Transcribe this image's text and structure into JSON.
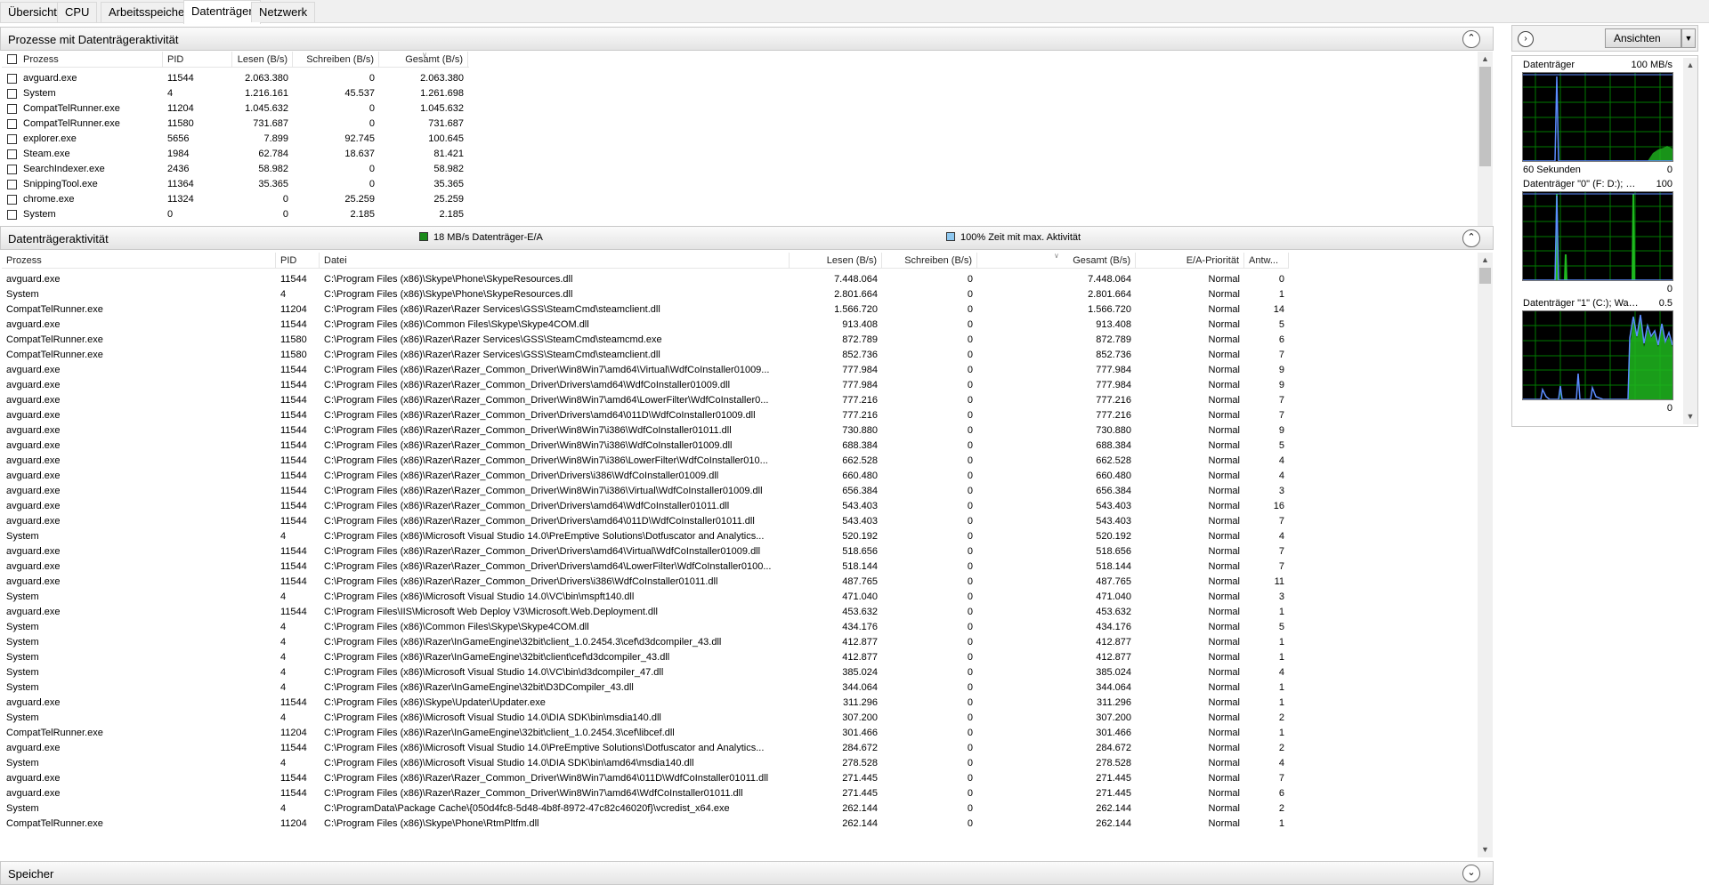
{
  "tabs": [
    {
      "label": "Übersicht",
      "active": false
    },
    {
      "label": "CPU",
      "active": false
    },
    {
      "label": "Arbeitsspeicher",
      "active": false
    },
    {
      "label": "Datenträger",
      "active": true
    },
    {
      "label": "Netzwerk",
      "active": false
    }
  ],
  "processes_section": {
    "title": "Prozesse mit Datenträgeraktivität",
    "columns": [
      "Prozess",
      "PID",
      "Lesen (B/s)",
      "Schreiben (B/s)",
      "Gesamt (B/s)"
    ],
    "rows": [
      [
        "avguard.exe",
        "11544",
        "2.063.380",
        "0",
        "2.063.380"
      ],
      [
        "System",
        "4",
        "1.216.161",
        "45.537",
        "1.261.698"
      ],
      [
        "CompatTelRunner.exe",
        "11204",
        "1.045.632",
        "0",
        "1.045.632"
      ],
      [
        "CompatTelRunner.exe",
        "11580",
        "731.687",
        "0",
        "731.687"
      ],
      [
        "explorer.exe",
        "5656",
        "7.899",
        "92.745",
        "100.645"
      ],
      [
        "Steam.exe",
        "1984",
        "62.784",
        "18.637",
        "81.421"
      ],
      [
        "SearchIndexer.exe",
        "2436",
        "58.982",
        "0",
        "58.982"
      ],
      [
        "SnippingTool.exe",
        "11364",
        "35.365",
        "0",
        "35.365"
      ],
      [
        "chrome.exe",
        "11324",
        "0",
        "25.259",
        "25.259"
      ],
      [
        "System",
        "0",
        "0",
        "2.185",
        "2.185"
      ]
    ]
  },
  "activity_section": {
    "title": "Datenträgeraktivität",
    "legend_io": "18 MB/s Datenträger-E/A",
    "legend_time": "100% Zeit mit max. Aktivität",
    "colors": {
      "io": "#1a8a1a",
      "time": "#8ec8f0"
    },
    "columns": [
      "Prozess",
      "PID",
      "Datei",
      "Lesen (B/s)",
      "Schreiben (B/s)",
      "Gesamt (B/s)",
      "E/A-Priorität",
      "Antw..."
    ],
    "rows": [
      [
        "avguard.exe",
        "11544",
        "C:\\Program Files (x86)\\Skype\\Phone\\SkypeResources.dll",
        "7.448.064",
        "0",
        "7.448.064",
        "Normal",
        "0"
      ],
      [
        "System",
        "4",
        "C:\\Program Files (x86)\\Skype\\Phone\\SkypeResources.dll",
        "2.801.664",
        "0",
        "2.801.664",
        "Normal",
        "1"
      ],
      [
        "CompatTelRunner.exe",
        "11204",
        "C:\\Program Files (x86)\\Razer\\Razer Services\\GSS\\SteamCmd\\steamclient.dll",
        "1.566.720",
        "0",
        "1.566.720",
        "Normal",
        "14"
      ],
      [
        "avguard.exe",
        "11544",
        "C:\\Program Files (x86)\\Common Files\\Skype\\Skype4COM.dll",
        "913.408",
        "0",
        "913.408",
        "Normal",
        "5"
      ],
      [
        "CompatTelRunner.exe",
        "11580",
        "C:\\Program Files (x86)\\Razer\\Razer Services\\GSS\\SteamCmd\\steamcmd.exe",
        "872.789",
        "0",
        "872.789",
        "Normal",
        "6"
      ],
      [
        "CompatTelRunner.exe",
        "11580",
        "C:\\Program Files (x86)\\Razer\\Razer Services\\GSS\\SteamCmd\\steamclient.dll",
        "852.736",
        "0",
        "852.736",
        "Normal",
        "7"
      ],
      [
        "avguard.exe",
        "11544",
        "C:\\Program Files (x86)\\Razer\\Razer_Common_Driver\\Win8Win7\\amd64\\Virtual\\WdfCoInstaller01009...",
        "777.984",
        "0",
        "777.984",
        "Normal",
        "9"
      ],
      [
        "avguard.exe",
        "11544",
        "C:\\Program Files (x86)\\Razer\\Razer_Common_Driver\\Drivers\\amd64\\WdfCoInstaller01009.dll",
        "777.984",
        "0",
        "777.984",
        "Normal",
        "9"
      ],
      [
        "avguard.exe",
        "11544",
        "C:\\Program Files (x86)\\Razer\\Razer_Common_Driver\\Win8Win7\\amd64\\LowerFilter\\WdfCoInstaller0...",
        "777.216",
        "0",
        "777.216",
        "Normal",
        "7"
      ],
      [
        "avguard.exe",
        "11544",
        "C:\\Program Files (x86)\\Razer\\Razer_Common_Driver\\Drivers\\amd64\\011D\\WdfCoInstaller01009.dll",
        "777.216",
        "0",
        "777.216",
        "Normal",
        "7"
      ],
      [
        "avguard.exe",
        "11544",
        "C:\\Program Files (x86)\\Razer\\Razer_Common_Driver\\Win8Win7\\i386\\WdfCoInstaller01011.dll",
        "730.880",
        "0",
        "730.880",
        "Normal",
        "9"
      ],
      [
        "avguard.exe",
        "11544",
        "C:\\Program Files (x86)\\Razer\\Razer_Common_Driver\\Win8Win7\\i386\\WdfCoInstaller01009.dll",
        "688.384",
        "0",
        "688.384",
        "Normal",
        "5"
      ],
      [
        "avguard.exe",
        "11544",
        "C:\\Program Files (x86)\\Razer\\Razer_Common_Driver\\Win8Win7\\i386\\LowerFilter\\WdfCoInstaller010...",
        "662.528",
        "0",
        "662.528",
        "Normal",
        "4"
      ],
      [
        "avguard.exe",
        "11544",
        "C:\\Program Files (x86)\\Razer\\Razer_Common_Driver\\Drivers\\i386\\WdfCoInstaller01009.dll",
        "660.480",
        "0",
        "660.480",
        "Normal",
        "4"
      ],
      [
        "avguard.exe",
        "11544",
        "C:\\Program Files (x86)\\Razer\\Razer_Common_Driver\\Win8Win7\\i386\\Virtual\\WdfCoInstaller01009.dll",
        "656.384",
        "0",
        "656.384",
        "Normal",
        "3"
      ],
      [
        "avguard.exe",
        "11544",
        "C:\\Program Files (x86)\\Razer\\Razer_Common_Driver\\Drivers\\amd64\\WdfCoInstaller01011.dll",
        "543.403",
        "0",
        "543.403",
        "Normal",
        "16"
      ],
      [
        "avguard.exe",
        "11544",
        "C:\\Program Files (x86)\\Razer\\Razer_Common_Driver\\Drivers\\amd64\\011D\\WdfCoInstaller01011.dll",
        "543.403",
        "0",
        "543.403",
        "Normal",
        "7"
      ],
      [
        "System",
        "4",
        "C:\\Program Files (x86)\\Microsoft Visual Studio 14.0\\PreEmptive Solutions\\Dotfuscator and Analytics...",
        "520.192",
        "0",
        "520.192",
        "Normal",
        "4"
      ],
      [
        "avguard.exe",
        "11544",
        "C:\\Program Files (x86)\\Razer\\Razer_Common_Driver\\Drivers\\amd64\\Virtual\\WdfCoInstaller01009.dll",
        "518.656",
        "0",
        "518.656",
        "Normal",
        "7"
      ],
      [
        "avguard.exe",
        "11544",
        "C:\\Program Files (x86)\\Razer\\Razer_Common_Driver\\Drivers\\amd64\\LowerFilter\\WdfCoInstaller0100...",
        "518.144",
        "0",
        "518.144",
        "Normal",
        "7"
      ],
      [
        "avguard.exe",
        "11544",
        "C:\\Program Files (x86)\\Razer\\Razer_Common_Driver\\Drivers\\i386\\WdfCoInstaller01011.dll",
        "487.765",
        "0",
        "487.765",
        "Normal",
        "11"
      ],
      [
        "System",
        "4",
        "C:\\Program Files (x86)\\Microsoft Visual Studio 14.0\\VC\\bin\\mspft140.dll",
        "471.040",
        "0",
        "471.040",
        "Normal",
        "3"
      ],
      [
        "avguard.exe",
        "11544",
        "C:\\Program Files\\IIS\\Microsoft Web Deploy V3\\Microsoft.Web.Deployment.dll",
        "453.632",
        "0",
        "453.632",
        "Normal",
        "1"
      ],
      [
        "System",
        "4",
        "C:\\Program Files (x86)\\Common Files\\Skype\\Skype4COM.dll",
        "434.176",
        "0",
        "434.176",
        "Normal",
        "5"
      ],
      [
        "System",
        "4",
        "C:\\Program Files (x86)\\Razer\\InGameEngine\\32bit\\client_1.0.2454.3\\cef\\d3dcompiler_43.dll",
        "412.877",
        "0",
        "412.877",
        "Normal",
        "1"
      ],
      [
        "System",
        "4",
        "C:\\Program Files (x86)\\Razer\\InGameEngine\\32bit\\client\\cef\\d3dcompiler_43.dll",
        "412.877",
        "0",
        "412.877",
        "Normal",
        "1"
      ],
      [
        "System",
        "4",
        "C:\\Program Files (x86)\\Microsoft Visual Studio 14.0\\VC\\bin\\d3dcompiler_47.dll",
        "385.024",
        "0",
        "385.024",
        "Normal",
        "4"
      ],
      [
        "System",
        "4",
        "C:\\Program Files (x86)\\Razer\\InGameEngine\\32bit\\D3DCompiler_43.dll",
        "344.064",
        "0",
        "344.064",
        "Normal",
        "1"
      ],
      [
        "avguard.exe",
        "11544",
        "C:\\Program Files (x86)\\Skype\\Updater\\Updater.exe",
        "311.296",
        "0",
        "311.296",
        "Normal",
        "1"
      ],
      [
        "System",
        "4",
        "C:\\Program Files (x86)\\Microsoft Visual Studio 14.0\\DIA SDK\\bin\\msdia140.dll",
        "307.200",
        "0",
        "307.200",
        "Normal",
        "2"
      ],
      [
        "CompatTelRunner.exe",
        "11204",
        "C:\\Program Files (x86)\\Razer\\InGameEngine\\32bit\\client_1.0.2454.3\\cef\\libcef.dll",
        "301.466",
        "0",
        "301.466",
        "Normal",
        "1"
      ],
      [
        "avguard.exe",
        "11544",
        "C:\\Program Files (x86)\\Microsoft Visual Studio 14.0\\PreEmptive Solutions\\Dotfuscator and Analytics...",
        "284.672",
        "0",
        "284.672",
        "Normal",
        "2"
      ],
      [
        "System",
        "4",
        "C:\\Program Files (x86)\\Microsoft Visual Studio 14.0\\DIA SDK\\bin\\amd64\\msdia140.dll",
        "278.528",
        "0",
        "278.528",
        "Normal",
        "4"
      ],
      [
        "avguard.exe",
        "11544",
        "C:\\Program Files (x86)\\Razer\\Razer_Common_Driver\\Win8Win7\\amd64\\011D\\WdfCoInstaller01011.dll",
        "271.445",
        "0",
        "271.445",
        "Normal",
        "7"
      ],
      [
        "avguard.exe",
        "11544",
        "C:\\Program Files (x86)\\Razer\\Razer_Common_Driver\\Win8Win7\\amd64\\WdfCoInstaller01011.dll",
        "271.445",
        "0",
        "271.445",
        "Normal",
        "6"
      ],
      [
        "System",
        "4",
        "C:\\ProgramData\\Package Cache\\{050d4fc8-5d48-4b8f-8972-47c82c46020f}\\vcredist_x64.exe",
        "262.144",
        "0",
        "262.144",
        "Normal",
        "2"
      ],
      [
        "CompatTelRunner.exe",
        "11204",
        "C:\\Program Files (x86)\\Skype\\Phone\\RtmPltfm.dll",
        "262.144",
        "0",
        "262.144",
        "Normal",
        "1"
      ]
    ]
  },
  "memory_section": {
    "title": "Speicher"
  },
  "right_panel": {
    "views_label": "Ansichten",
    "graphs": [
      {
        "title": "Datenträger",
        "max_label": "100 MB/s",
        "footer_left": "60 Sekunden",
        "footer_right": "0"
      },
      {
        "title": "Datenträger \"0\" (F: D:); W...",
        "max_label": "100",
        "footer_left": "",
        "footer_right": "0"
      },
      {
        "title": "Datenträger \"1\" (C:); Wart...",
        "max_label": "0.5",
        "footer_left": "",
        "footer_right": "0"
      }
    ]
  }
}
